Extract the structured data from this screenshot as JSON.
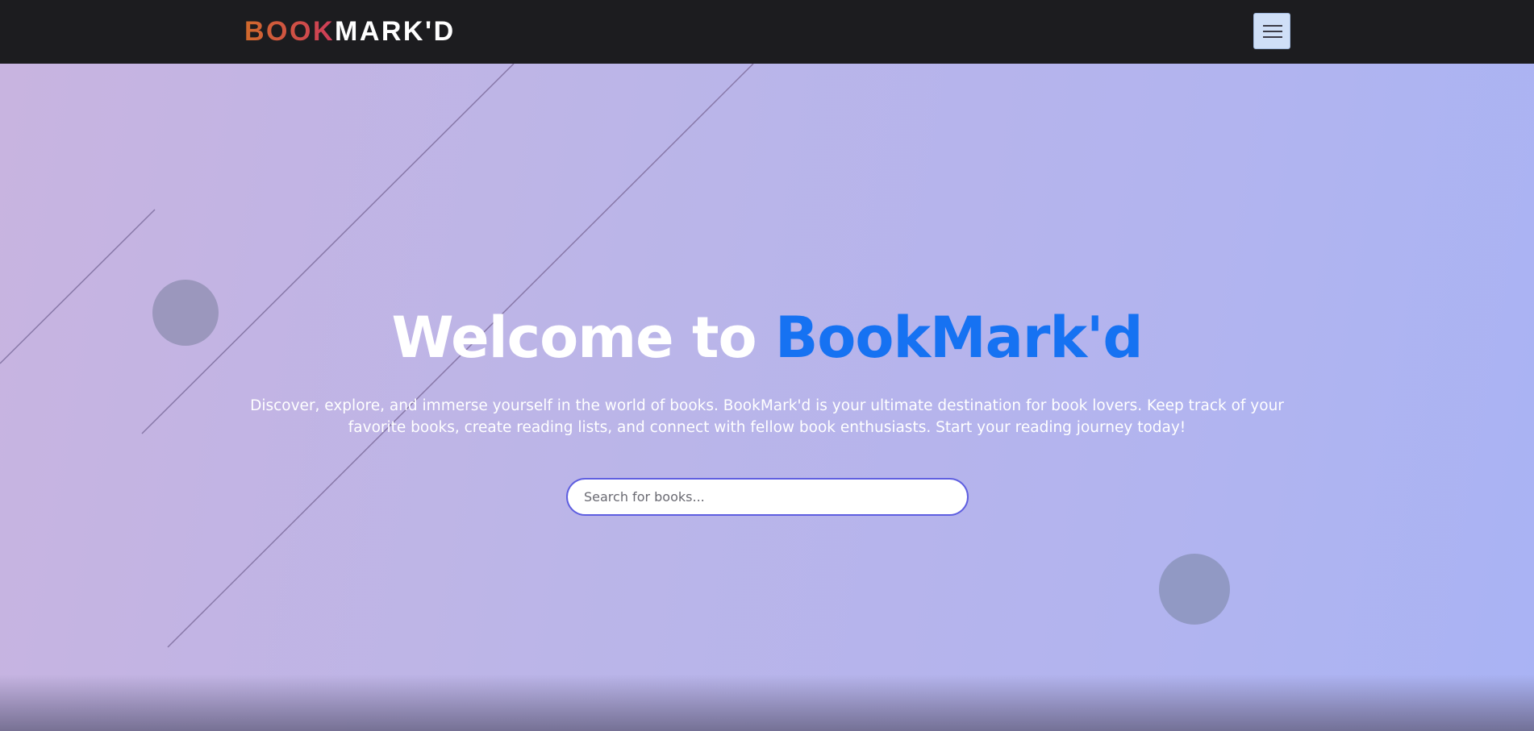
{
  "brand": {
    "part1": "BOOK",
    "part2": "MARK'D"
  },
  "nav": {
    "menu_icon": "hamburger-menu-icon"
  },
  "hero": {
    "title_part1": "Welcome to ",
    "title_part2": "BookMark'd",
    "subtitle": "Discover, explore, and immerse yourself in the world of books. BookMark'd is your ultimate destination for book lovers. Keep track of your favorite books, create reading lists, and connect with fellow book enthusiasts. Start your reading journey today!",
    "search_placeholder": "Search for books..."
  },
  "colors": {
    "navbar": "#1c1c1f",
    "brand_gradient_start": "#d06a2c",
    "brand_gradient_end": "#cf3c5a",
    "accent": "#1672f2",
    "hero_gradient_start": "#c8b4e0",
    "hero_gradient_end": "#a9b3f4",
    "search_border": "#5e5ee0"
  }
}
